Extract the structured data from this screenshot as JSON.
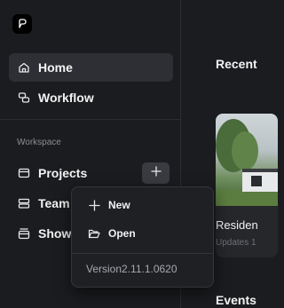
{
  "sidebar": {
    "nav": [
      {
        "label": "Home",
        "icon": "home-icon"
      },
      {
        "label": "Workflow",
        "icon": "workflow-icon"
      }
    ],
    "section_label": "Workspace",
    "workspace_items": [
      {
        "label": "Projects",
        "icon": "folder-window-icon"
      },
      {
        "label": "Team",
        "icon": "list-icon"
      },
      {
        "label": "Show",
        "icon": "archive-icon"
      }
    ]
  },
  "main": {
    "recent_title": "Recent",
    "card": {
      "title": "Residen",
      "subtitle": "Updates 1"
    },
    "events_title": "Events"
  },
  "popup": {
    "items": [
      {
        "label": "New",
        "icon": "plus-icon"
      },
      {
        "label": "Open",
        "icon": "folder-open-icon"
      }
    ],
    "version": "Version2.11.1.0620"
  },
  "colors": {
    "background": "#1b1c1f",
    "active_item": "#2e2f34",
    "popup": "#1f2024"
  }
}
